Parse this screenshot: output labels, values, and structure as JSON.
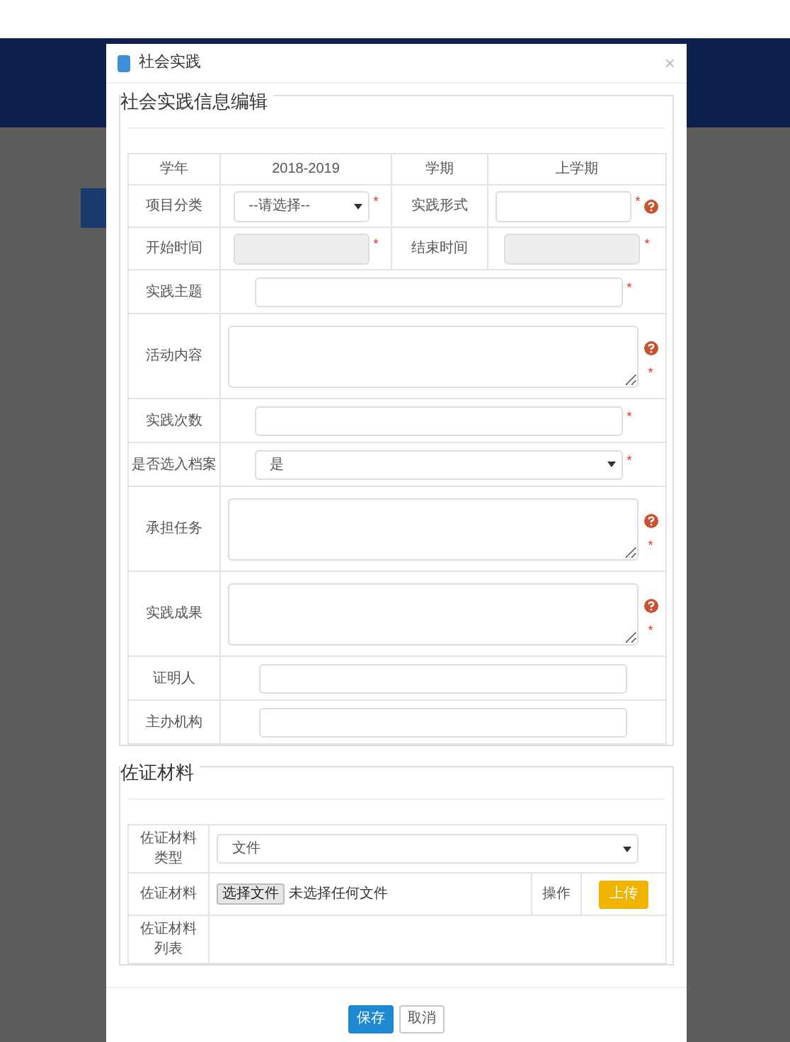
{
  "dialog": {
    "title": "社会实践",
    "close": "×"
  },
  "info_section": {
    "legend": "社会实践信息编辑",
    "pair_rows": [
      {
        "cells": [
          {
            "kind": "label",
            "text": "学年"
          },
          {
            "kind": "text",
            "text": "2018-2019"
          },
          {
            "kind": "label",
            "text": "学期"
          },
          {
            "kind": "text",
            "text": "上学期"
          }
        ]
      },
      {
        "cells": [
          {
            "kind": "label",
            "text": "项目分类"
          },
          {
            "kind": "select",
            "value": "--请选择--",
            "mark": "*"
          },
          {
            "kind": "label",
            "text": "实践形式"
          },
          {
            "kind": "input",
            "mark": "*",
            "help": true
          }
        ]
      },
      {
        "cells": [
          {
            "kind": "label",
            "text": "开始时间"
          },
          {
            "kind": "input",
            "mark": "*",
            "disabled": true
          },
          {
            "kind": "label",
            "text": "结束时间"
          },
          {
            "kind": "input",
            "mark": "*",
            "disabled": true
          }
        ]
      }
    ],
    "rows": [
      {
        "label": "实践主题",
        "field": {
          "kind": "input",
          "mark": "*"
        }
      },
      {
        "label": "活动内容",
        "field": {
          "kind": "textarea",
          "mark": "*",
          "help": true
        }
      },
      {
        "label": "实践次数",
        "field": {
          "kind": "input",
          "mark": "*"
        }
      },
      {
        "label": "是否选入档案",
        "field": {
          "kind": "select",
          "value": "是",
          "mark": "*"
        }
      },
      {
        "label": "承担任务",
        "field": {
          "kind": "textarea",
          "mark": "*",
          "help": true
        }
      },
      {
        "label": "实践成果",
        "field": {
          "kind": "textarea",
          "mark": "*",
          "help": true
        }
      },
      {
        "label": "证明人",
        "field": {
          "kind": "input"
        }
      },
      {
        "label": "主办机构",
        "field": {
          "kind": "input"
        }
      }
    ]
  },
  "evidence_section": {
    "legend": "佐证材料",
    "type_row": {
      "label": "佐证材料类型",
      "select_value": "文件"
    },
    "file_row": {
      "label": "佐证材料",
      "choose_button": "选择文件",
      "file_status": "未选择任何文件",
      "action_label": "操作",
      "upload_button": "上传"
    },
    "list_row": {
      "label": "佐证材料列表"
    }
  },
  "footer": {
    "buttons": [
      {
        "label": "保存",
        "primary": true
      },
      {
        "label": "取消",
        "primary": false
      }
    ]
  }
}
